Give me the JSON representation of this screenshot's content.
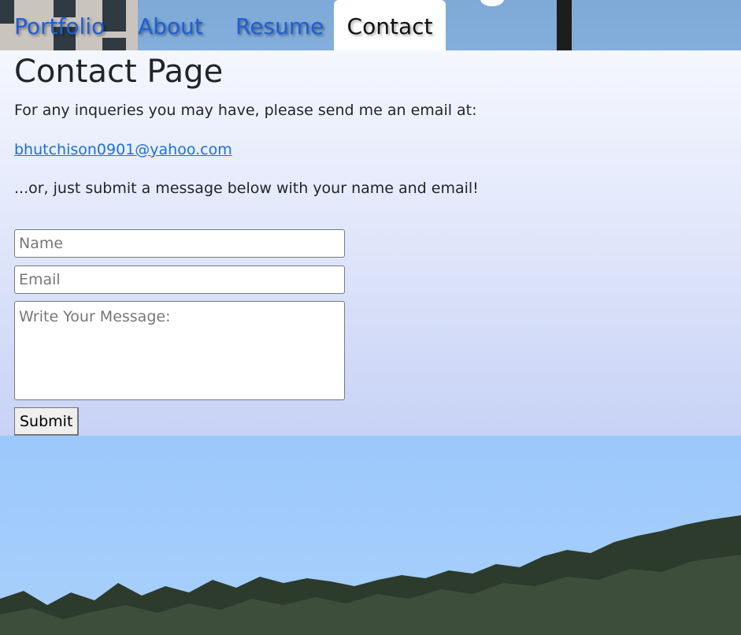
{
  "nav": {
    "items": [
      {
        "label": "Portfolio"
      },
      {
        "label": "About"
      },
      {
        "label": "Resume"
      },
      {
        "label": "Contact"
      }
    ],
    "active": "Contact"
  },
  "content": {
    "title": "Contact Page",
    "intro": "For any inqueries you may have, please send me an email at:",
    "email": "bhutchison0901@yahoo.com",
    "alt_text": "...or, just submit a message below with your name and email!"
  },
  "form": {
    "name_placeholder": "Name",
    "name_value": "",
    "email_placeholder": "Email",
    "email_value": "",
    "message_placeholder": "Write Your Message:",
    "message_value": "",
    "submit_label": "Submit"
  },
  "colors": {
    "link": "#1a6fe0",
    "nav_link": "#1d5fd9",
    "text": "#212529"
  }
}
